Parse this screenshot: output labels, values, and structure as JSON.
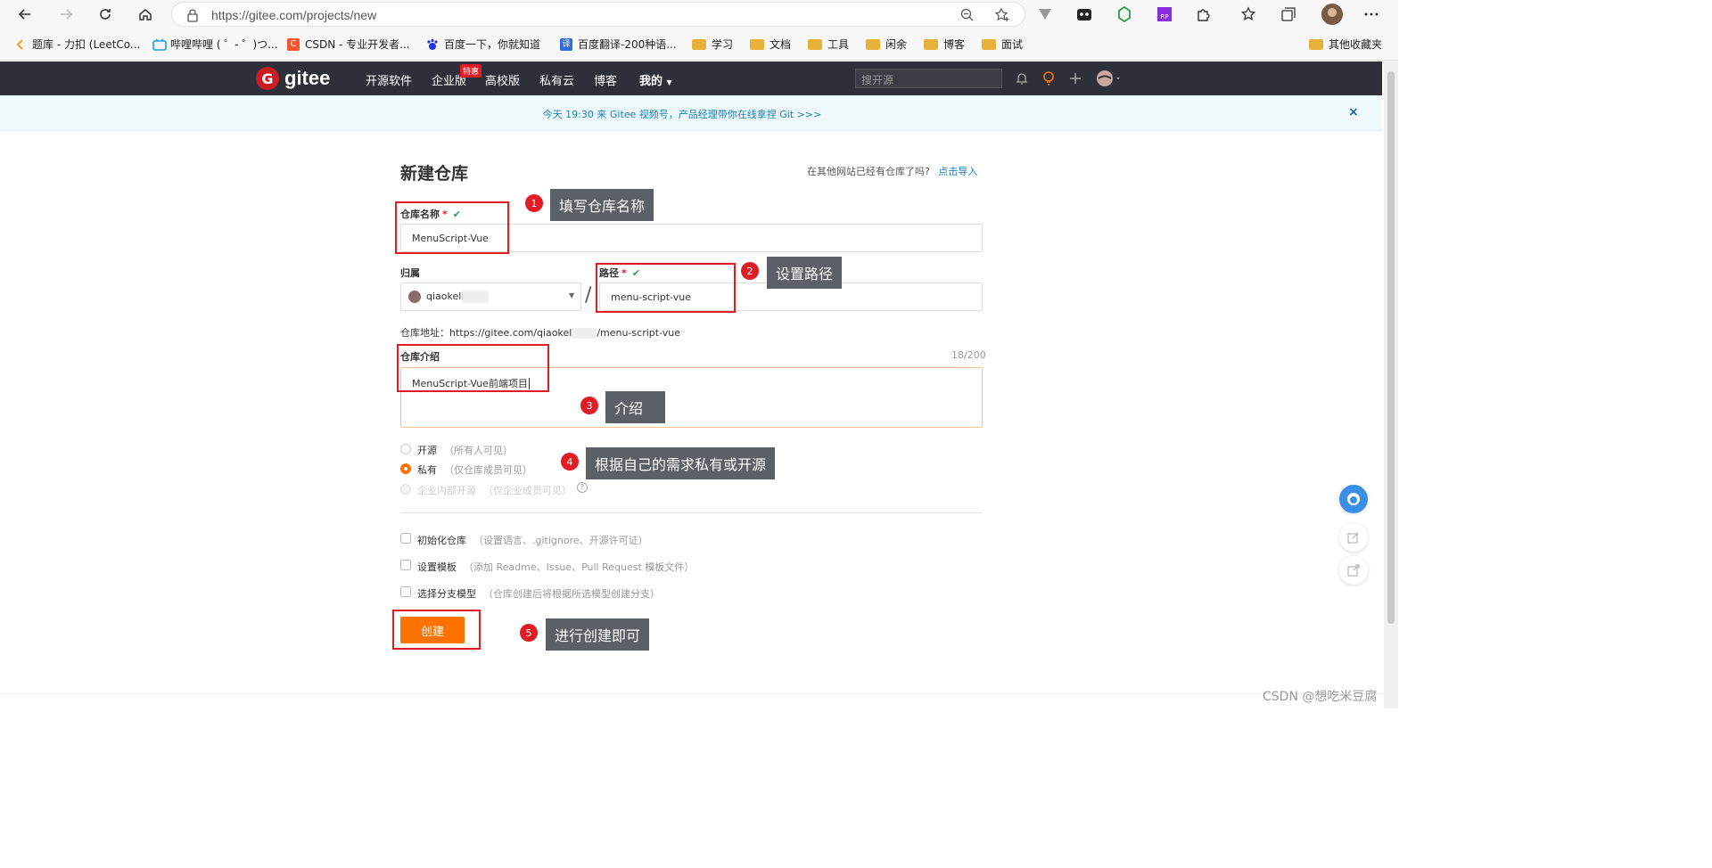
{
  "browser": {
    "url": "https://gitee.com/projects/new",
    "bookmarks": [
      {
        "label": "题库 - 力扣 (LeetCo...",
        "icon": "leetcode-icon"
      },
      {
        "label": "哔哩哔哩 ( ゜- ゜)つ...",
        "icon": "bilibili-icon"
      },
      {
        "label": "CSDN - 专业开发者...",
        "icon": "csdn-icon"
      },
      {
        "label": "百度一下，你就知道",
        "icon": "baidu-icon"
      },
      {
        "label": "百度翻译-200种语...",
        "icon": "translate-icon"
      },
      {
        "label": "学习",
        "icon": "folder-icon"
      },
      {
        "label": "文档",
        "icon": "folder-icon"
      },
      {
        "label": "工具",
        "icon": "folder-icon"
      },
      {
        "label": "闲余",
        "icon": "folder-icon"
      },
      {
        "label": "博客",
        "icon": "folder-icon"
      },
      {
        "label": "面试",
        "icon": "folder-icon"
      }
    ],
    "other_bookmarks": "其他收藏夹"
  },
  "gitee": {
    "logo_text": "gitee",
    "nav": [
      "开源软件",
      "企业版",
      "高校版",
      "私有云",
      "博客",
      "我的"
    ],
    "badge": "特惠",
    "search_placeholder": "搜开源",
    "notice": "今天 19:30 来 Gitee 视频号，产品经理带你在线拿捏 Git >>>",
    "notice_close": "×"
  },
  "form": {
    "title": "新建仓库",
    "import_prompt": "在其他网站已经有仓库了吗?",
    "import_link": "点击导入",
    "name_label": "仓库名称",
    "name_value": "MenuScript-Vue",
    "owner_label": "归属",
    "owner_value": "qiaokeli",
    "slash": "/",
    "path_label": "路径",
    "path_value": "menu-script-vue",
    "address_label": "仓库地址：",
    "address_prefix": "https://gitee.com/qiaokel",
    "address_suffix": "/menu-script-vue",
    "intro_label": "仓库介绍",
    "intro_count": "18/200",
    "intro_value": "MenuScript-Vue前端项目",
    "visibility": [
      {
        "label": "开源",
        "hint": "（所有人可见）",
        "selected": false,
        "disabled": false
      },
      {
        "label": "私有",
        "hint": "（仅仓库成员可见）",
        "selected": true,
        "disabled": false
      },
      {
        "label": "企业内部开源",
        "hint": "（仅企业成员可见）",
        "selected": false,
        "disabled": true
      }
    ],
    "options": [
      {
        "label": "初始化仓库",
        "hint": "（设置语言、.gitignore、开源许可证）"
      },
      {
        "label": "设置模板",
        "hint": "（添加 Readme、Issue、Pull Request 模板文件）"
      },
      {
        "label": "选择分支模型",
        "hint": "（仓库创建后将根据所选模型创建分支）"
      }
    ],
    "create_button": "创建"
  },
  "annotations": [
    {
      "num": "1",
      "text": "填写仓库名称"
    },
    {
      "num": "2",
      "text": "设置路径"
    },
    {
      "num": "3",
      "text": "介绍"
    },
    {
      "num": "4",
      "text": "根据自己的需求私有或开源"
    },
    {
      "num": "5",
      "text": "进行创建即可"
    }
  ],
  "watermark": "CSDN @想吃米豆腐",
  "colors": {
    "accent": "#fe7300",
    "header": "#2d3038",
    "annotation_red": "#e11c24",
    "callout_bg": "#5b5f66"
  }
}
